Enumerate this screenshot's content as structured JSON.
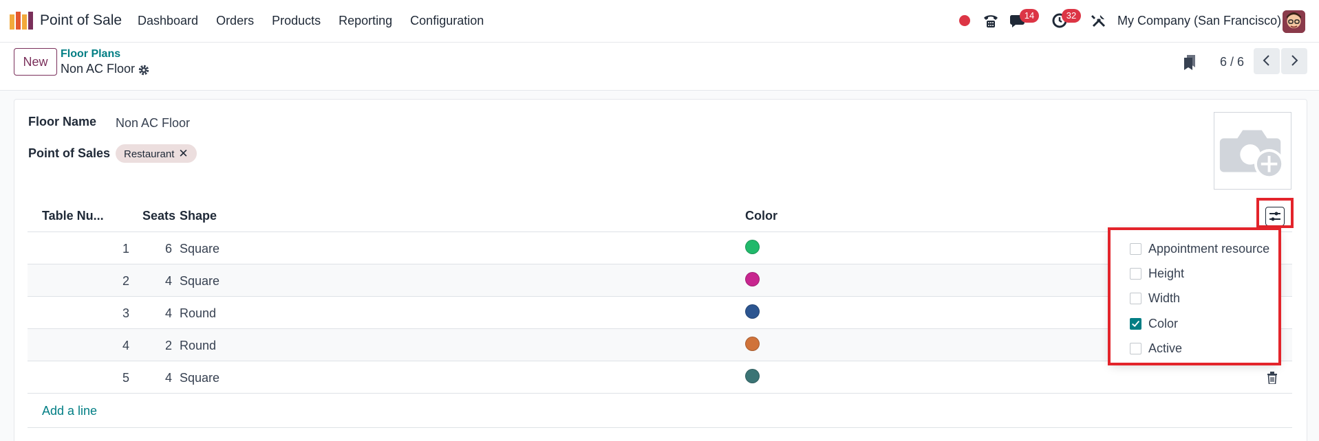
{
  "navbar": {
    "app_name": "Point of Sale",
    "menu": [
      "Dashboard",
      "Orders",
      "Products",
      "Reporting",
      "Configuration"
    ],
    "chat_badge": "14",
    "activity_badge": "32",
    "company": "My Company (San Francisco)"
  },
  "control": {
    "new_label": "New",
    "breadcrumb": "Floor Plans",
    "record_title": "Non AC Floor",
    "pager": "6 / 6"
  },
  "form": {
    "floor_name_label": "Floor Name",
    "floor_name_value": "Non AC Floor",
    "pos_label": "Point of Sales",
    "pos_tag": "Restaurant"
  },
  "list": {
    "headers": {
      "table_number": "Table Nu...",
      "seats": "Seats",
      "shape": "Shape",
      "color": "Color"
    },
    "rows": [
      {
        "table": "1",
        "seats": "6",
        "shape": "Square",
        "color": "#21b96b"
      },
      {
        "table": "2",
        "seats": "4",
        "shape": "Square",
        "color": "#c8268f"
      },
      {
        "table": "3",
        "seats": "4",
        "shape": "Round",
        "color": "#2c5590"
      },
      {
        "table": "4",
        "seats": "2",
        "shape": "Round",
        "color": "#d0733a"
      },
      {
        "table": "5",
        "seats": "4",
        "shape": "Square",
        "color": "#3b7475"
      }
    ],
    "add_line": "Add a line"
  },
  "optional_columns": [
    {
      "label": "Appointment resource",
      "checked": false
    },
    {
      "label": "Height",
      "checked": false
    },
    {
      "label": "Width",
      "checked": false
    },
    {
      "label": "Color",
      "checked": true
    },
    {
      "label": "Active",
      "checked": false
    }
  ]
}
